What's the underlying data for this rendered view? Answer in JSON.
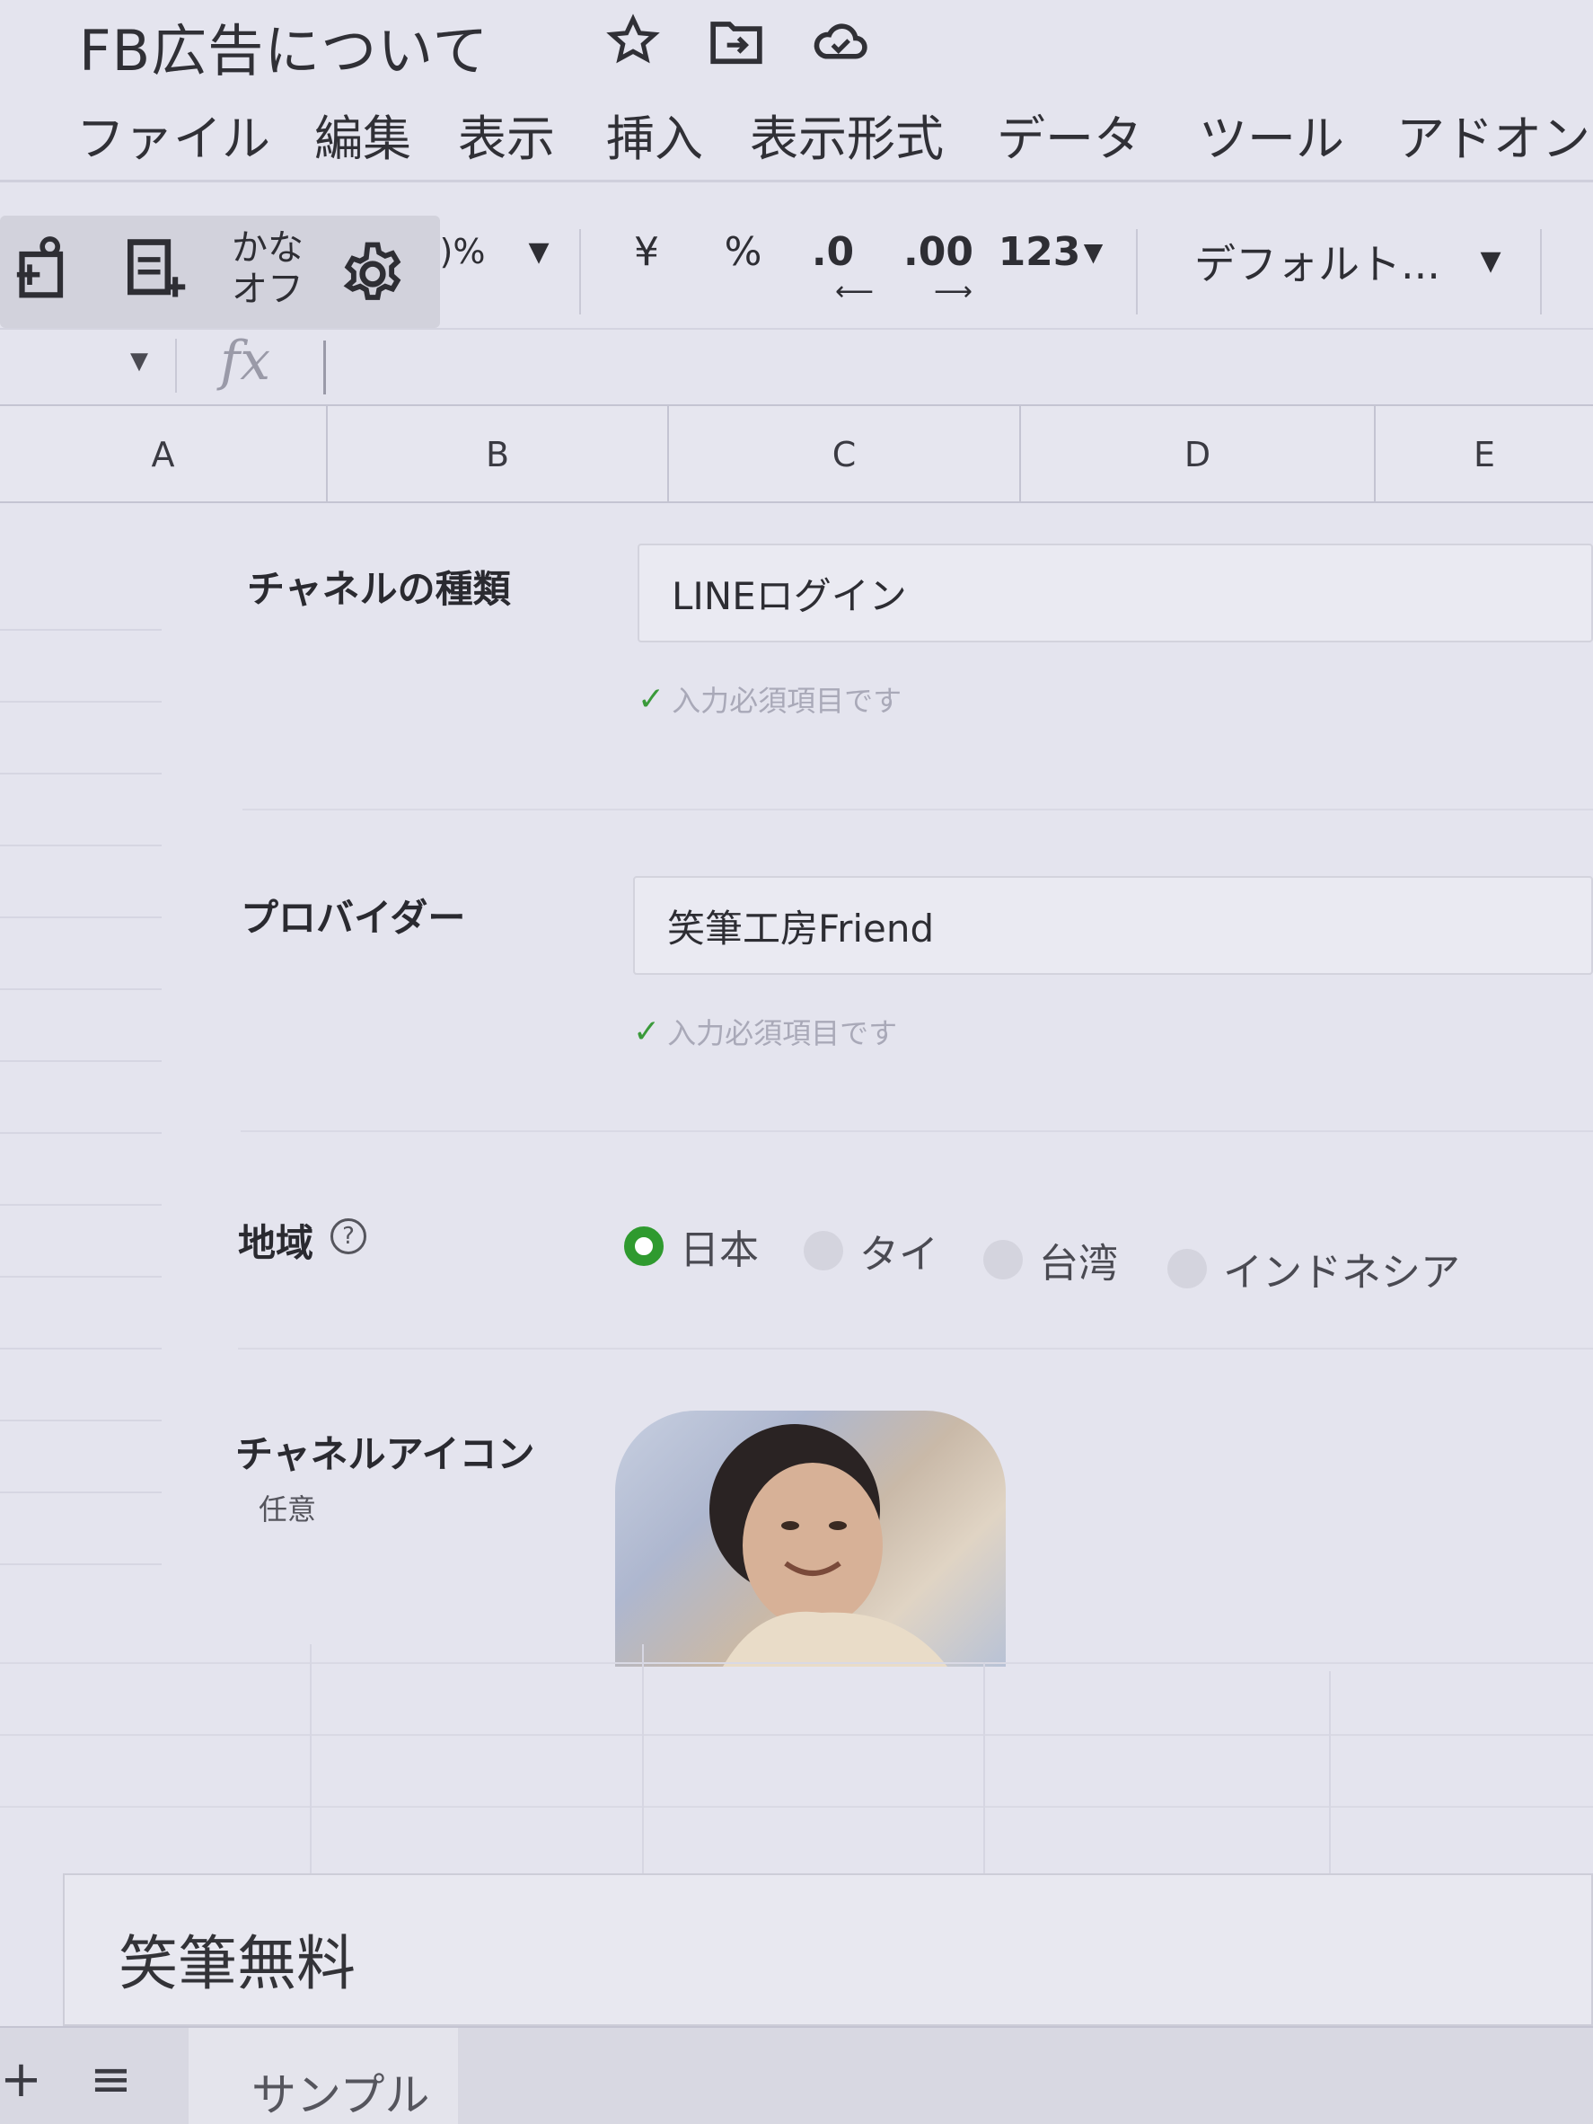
{
  "title_bar": {
    "title": "FB広告について",
    "star_icon": "star-icon",
    "move_icon": "folder-move-icon",
    "cloud_icon": "cloud-status-icon"
  },
  "menu": {
    "items": [
      "ファイル",
      "編集",
      "表示",
      "挿入",
      "表示形式",
      "データ",
      "ツール",
      "アドオン"
    ]
  },
  "toolbar": {
    "kana_label": "かな",
    "off_label": "オフ",
    "zoom_suffix": ")%",
    "currency": "¥",
    "percent": "%",
    "decrease_decimal": ".0",
    "increase_decimal": ".00",
    "number_format": "123",
    "font": "デフォルト..."
  },
  "formula_bar": {
    "fx": "fx"
  },
  "columns": [
    "A",
    "B",
    "C",
    "D",
    "E"
  ],
  "form": {
    "channel_type": {
      "label": "チャネルの種類",
      "value": "LINEログイン",
      "validation": "入力必須項目です"
    },
    "provider": {
      "label": "プロバイダー",
      "value": "笑筆工房Friend",
      "validation": "入力必須項目です"
    },
    "region": {
      "label": "地域",
      "options": [
        "日本",
        "タイ",
        "台湾",
        "インドネシア"
      ],
      "selected": "日本"
    },
    "channel_icon": {
      "label": "チャネルアイコン",
      "sublabel": "任意"
    }
  },
  "bottom_cell": {
    "text": "笑筆無料"
  },
  "sheet_tabs": {
    "add": "+",
    "list": "≡",
    "sheet_name": "サンプル"
  }
}
